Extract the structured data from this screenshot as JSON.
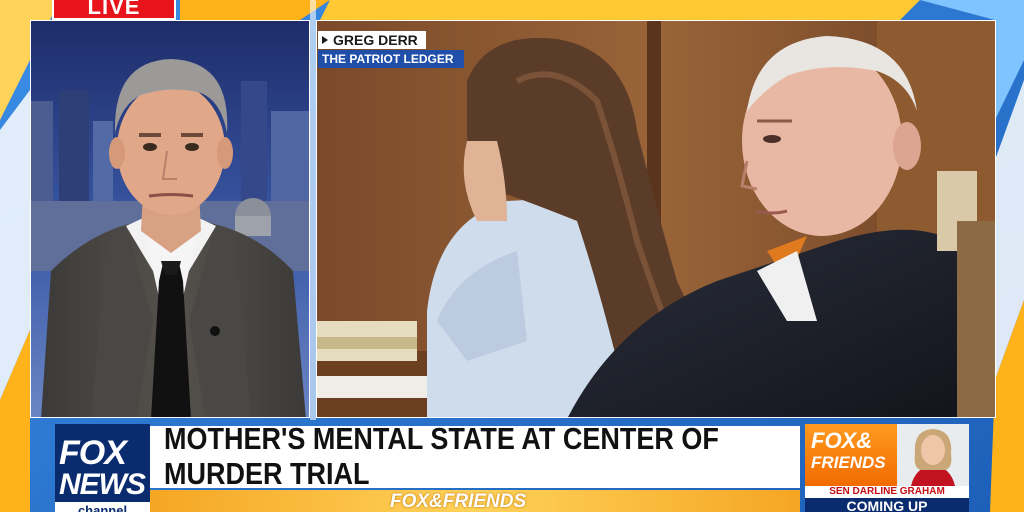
{
  "live_bug": {
    "label": "LIVE"
  },
  "credit": {
    "name": "GREG DERR",
    "outlet": "THE PATRIOT LEDGER"
  },
  "lower_third": {
    "network_logo": {
      "line1": "FOX",
      "line2": "NEWS",
      "line3": "channel"
    },
    "headline": "MOTHER'S MENTAL STATE AT CENTER OF MURDER TRIAL",
    "show_name": "FOX&FRIENDS"
  },
  "promo": {
    "logo_line1": "FOX&",
    "logo_line2": "FRIENDS",
    "guest": "SEN DARLINE GRAHAM",
    "label": "COMING UP"
  },
  "colors": {
    "live_red": "#e8141c",
    "fox_navy": "#0a2c6e",
    "credit_blue": "#1f4fa8",
    "show_orange": "#f5a623",
    "promo_red": "#c40c12"
  }
}
